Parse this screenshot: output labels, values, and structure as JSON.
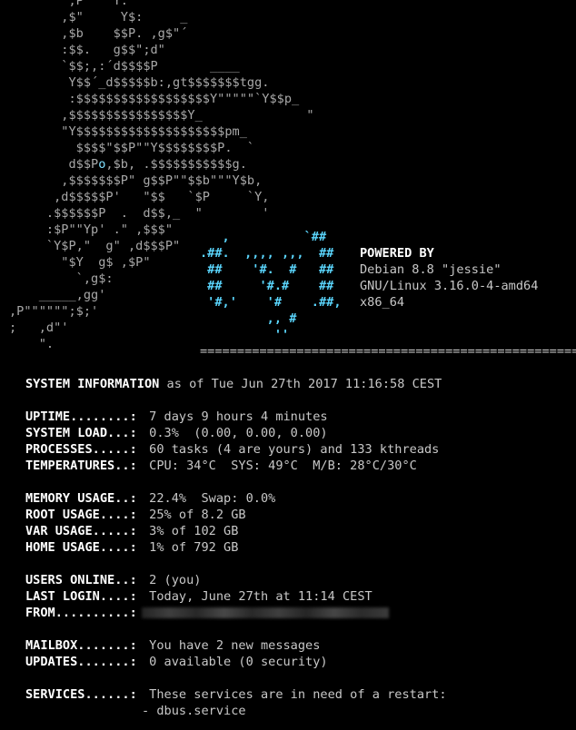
{
  "art_lines": [
    "        ;P   \"Y.",
    "       ,$\"     Y$:     _",
    "       ,$b    $$P. ,g$\"´",
    "       :$$.   g$$\";d\"",
    "       `$$;,:´d$$$$P       ____",
    "        Y$$´_d$$$$$b:,gt$$$$$$$tgg.",
    "        :$$$$$$$$$$$$$$$$$$Y\"\"\"\"\"`Y$$p_",
    "       ,$$$$$$$$$$$$$$$$Y_              \"",
    "       \"Y$$$$$$$$$$$$$$$$$$$$pm_",
    "         $$$$\"$$P\"\"Y$$$$$$$$P.  `",
    "        d$$P",
    "       ,$$$$$$$P\" g$$P\"\"$$b\"\"\"Y$b,",
    "      ,d$$$$$P'   \"$$   `$P     `Y,",
    "     .$$$$$$P  .  d$$,_  \"        '",
    "     :$P\"\"Yp' .\" ,$$$\"",
    "     `Y$P,\"  g\" ,d$$$P\"",
    "       \"$Y  g$ ,$P\"",
    "         `,g$:",
    "    _____,gg'",
    ",P\"\"\"\"\"\";$;'",
    ";   ,d\"'",
    "    \"."
  ],
  "art_line10_circle": "o",
  "art_line10_tail": ",$b, .$$$$$$$$$$$g.",
  "logo_lines": [
    "   ,          `##",
    ".##.  ,,,, ,,,  ##",
    " ##    '#.  #   ##",
    " ##     '#.#    ##",
    " '#,'    '#    .##,",
    "         ,, #",
    "          ''"
  ],
  "powered": {
    "label": "POWERED BY",
    "os": "Debian 8.8 \"jessie\"",
    "kernel": "GNU/Linux 3.16.0-4-amd64",
    "arch": "x86_64"
  },
  "separator": "===================================================",
  "sysinfo": {
    "label": "SYSTEM INFORMATION",
    "as_of": " as of Tue Jun 27th 2017 11:16:58 CEST"
  },
  "rows": {
    "uptime": {
      "key": "UPTIME........:",
      "value": " 7 days 9 hours 4 minutes"
    },
    "load": {
      "key": "SYSTEM LOAD...:",
      "value": " 0.3%  (0.00, 0.00, 0.00)"
    },
    "proc": {
      "key": "PROCESSES.....:",
      "value": " 60 tasks (4 are yours) and 133 kthreads"
    },
    "temp": {
      "key": "TEMPERATURES..:",
      "value": " CPU: 34°C  SYS: 49°C  M/B: 28°C/30°C"
    },
    "mem": {
      "key": "MEMORY USAGE..:",
      "value": " 22.4%  Swap: 0.0%"
    },
    "root": {
      "key": "ROOT USAGE....:",
      "value": " 25% of 8.2 GB"
    },
    "var": {
      "key": "VAR USAGE.....:",
      "value": " 3% of 102 GB"
    },
    "home": {
      "key": "HOME USAGE....:",
      "value": " 1% of 792 GB"
    },
    "users": {
      "key": "USERS ONLINE..:",
      "value": " 2 (you)"
    },
    "login": {
      "key": "LAST LOGIN....:",
      "value": " Today, June 27th at 11:14 CEST"
    },
    "from": {
      "key": "FROM..........:"
    },
    "mail": {
      "key": "MAILBOX.......:",
      "value": " You have 2 new messages"
    },
    "updates": {
      "key": "UPDATES.......:",
      "value": " 0 available (0 security)"
    },
    "services": {
      "key": "SERVICES......:",
      "value": " These services are in need of a restart:"
    }
  },
  "services_list": [
    "- dbus.service"
  ],
  "colors": {
    "background": "#000000",
    "text": "#c8c8c8",
    "logo": "#5bd7ff",
    "bold": "#ffffff"
  }
}
